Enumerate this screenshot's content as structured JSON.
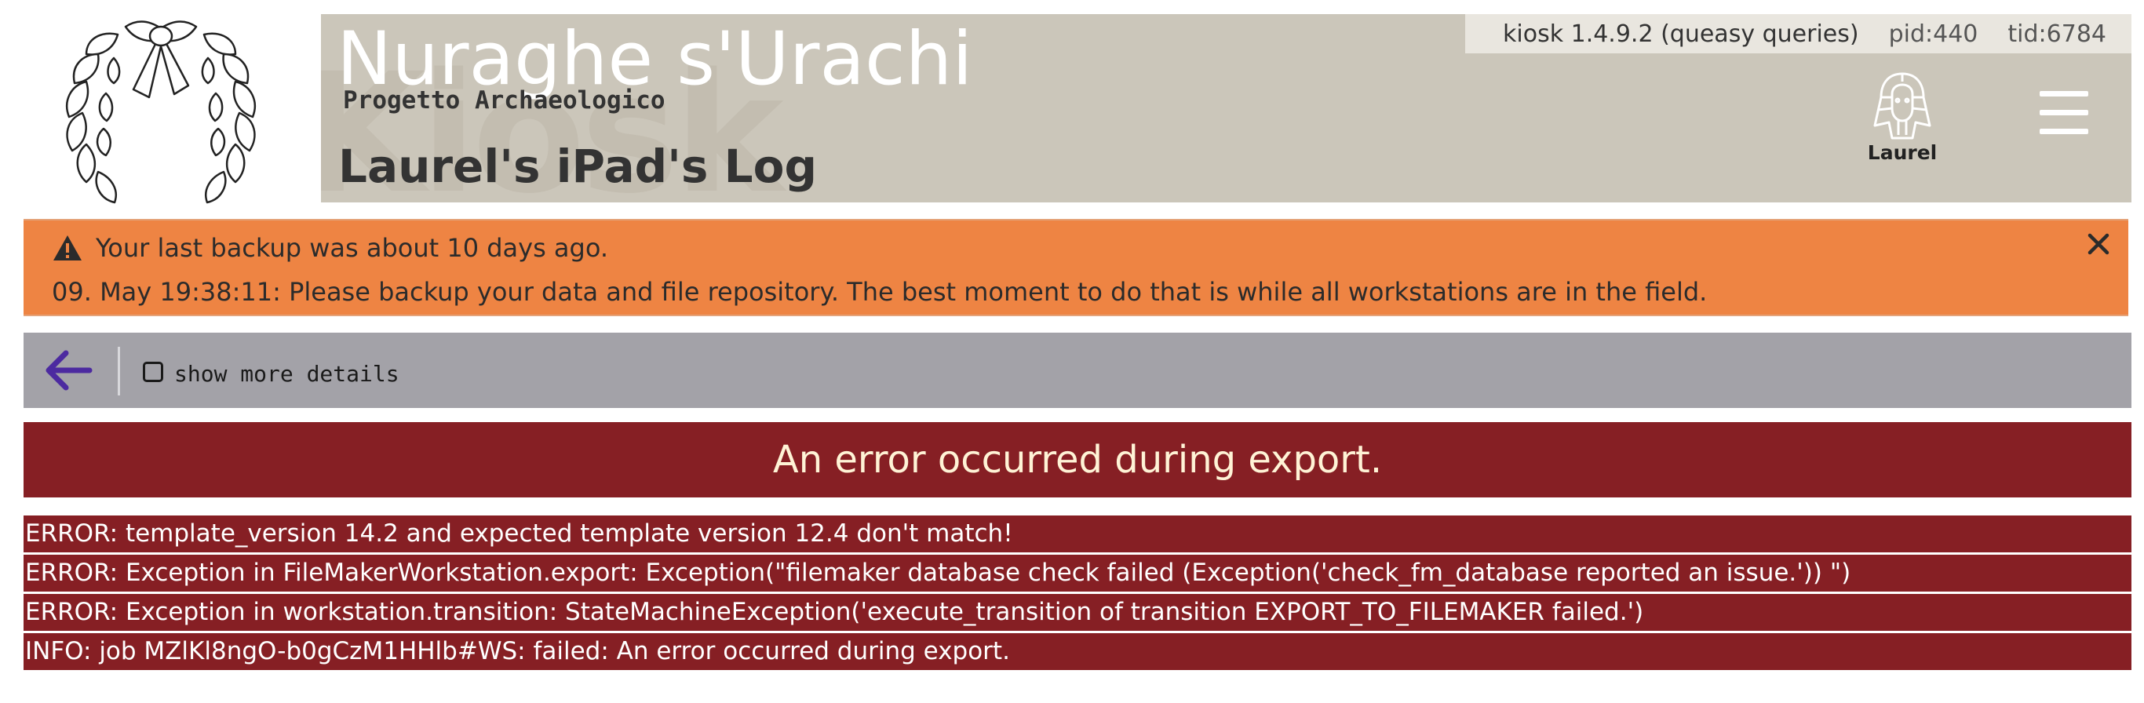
{
  "header": {
    "site_title": "Nuraghe s'Urachi",
    "site_subtitle": "Progetto Archaeologico",
    "watermark": "Kiosk",
    "page_title": "Laurel's iPad's Log",
    "version": "kiosk 1.4.9.2 (queasy queries)",
    "pid": "pid:440",
    "tid": "tid:6784",
    "user_name": "Laurel",
    "user_icon": "pharaoh-avatar-icon",
    "menu_icon": "hamburger-menu-icon"
  },
  "notice": {
    "title": "Your last backup was about 10 days ago.",
    "message": "09. May 19:38:11: Please backup your data and file repository. The best moment to do that is while all workstations are in the field.",
    "icon": "warning-icon",
    "close_icon": "close-icon",
    "color": "#ee8443"
  },
  "toolbar": {
    "back_icon": "arrow-left-icon",
    "show_more_label": "show more details",
    "show_more_checked": false
  },
  "error_banner": {
    "text": "An error occurred during export.",
    "color": "#861f24"
  },
  "log": [
    "ERROR: template_version 14.2 and expected template version 12.4 don't match!",
    "ERROR: Exception in FileMakerWorkstation.export: Exception(\"filemaker database check failed (Exception('check_fm_database reported an issue.')) \")",
    "ERROR: Exception in workstation.transition: StateMachineException('execute_transition of transition EXPORT_TO_FILEMAKER failed.')",
    "INFO: job MZlKl8ngO-b0gCzM1HHlb#WS: failed: An error occurred during export."
  ]
}
